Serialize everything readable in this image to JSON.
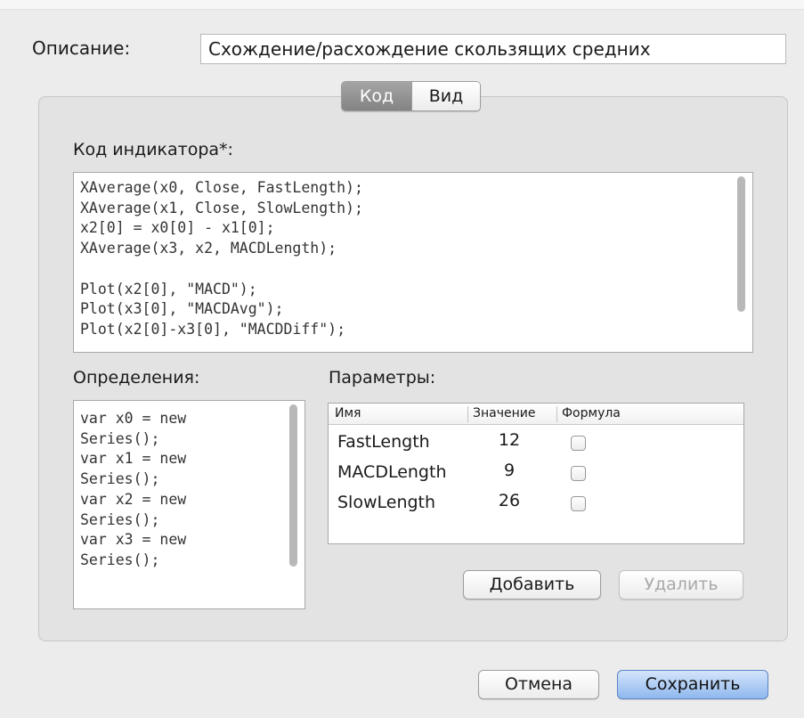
{
  "description": {
    "label": "Описание:",
    "value": "Схождение/расхождение скользящих средних"
  },
  "tabs": {
    "code": "Код",
    "view": "Вид",
    "active": "code"
  },
  "code": {
    "label": "Код индикатора*:",
    "text": "XAverage(x0, Close, FastLength);\nXAverage(x1, Close, SlowLength);\nx2[0] = x0[0] - x1[0];\nXAverage(x3, x2, MACDLength);\n\nPlot(x2[0], \"MACD\");\nPlot(x3[0], \"MACDAvg\");\nPlot(x2[0]-x3[0], \"MACDDiff\");"
  },
  "definitions": {
    "label": "Определения:",
    "text": "var x0 = new\nSeries();\nvar x1 = new\nSeries();\nvar x2 = new\nSeries();\nvar x3 = new\nSeries();"
  },
  "params": {
    "label": "Параметры:",
    "headers": {
      "name": "Имя",
      "value": "Значение",
      "formula": "Формула"
    },
    "rows": [
      {
        "name": "FastLength",
        "value": "12",
        "formula": false
      },
      {
        "name": "MACDLength",
        "value": "9",
        "formula": false
      },
      {
        "name": "SlowLength",
        "value": "26",
        "formula": false
      }
    ],
    "add_label": "Добавить",
    "delete_label": "Удалить"
  },
  "footer": {
    "cancel_label": "Отмена",
    "save_label": "Сохранить"
  }
}
